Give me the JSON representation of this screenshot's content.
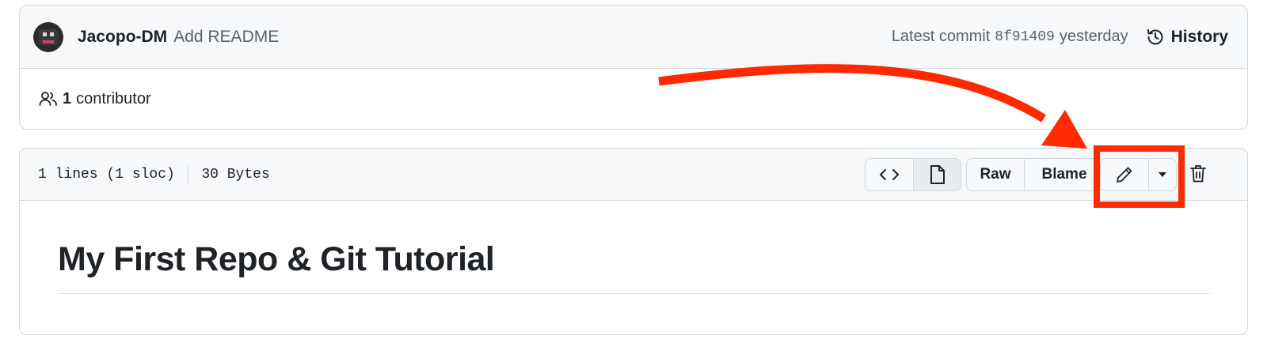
{
  "commit": {
    "author": "Jacopo-DM",
    "message": "Add README",
    "latest_label": "Latest commit",
    "sha": "8f91409",
    "time": "yesterday",
    "history_label": "History"
  },
  "contributors": {
    "count": "1",
    "label": "contributor"
  },
  "file": {
    "lines": "1 lines (1 sloc)",
    "size": "30 Bytes",
    "buttons": {
      "raw": "Raw",
      "blame": "Blame"
    },
    "readme_title": "My First Repo & Git Tutorial"
  },
  "icons": {
    "history": "history-icon",
    "people": "people-icon",
    "code": "code-icon",
    "file": "file-icon",
    "pencil": "pencil-icon",
    "dropdown": "triangle-down-icon",
    "trash": "trash-icon"
  },
  "annotation_colors": {
    "arrow": "#ff2a00",
    "highlight": "#ff2a00"
  }
}
